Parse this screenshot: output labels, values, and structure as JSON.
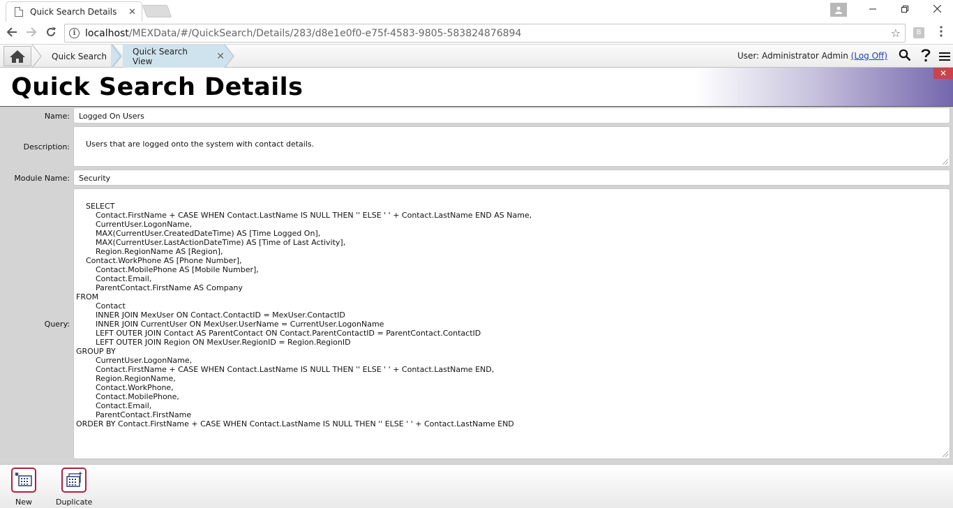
{
  "browser": {
    "tab_title": "Quick Search Details",
    "tab_close": "✕",
    "url_host": "localhost",
    "url_path": "/MEXData/#/QuickSearch/Details/283/d8e1e0f0-e75f-4583-9805-583824876894",
    "ext_badge": "B"
  },
  "nav": {
    "breadcrumbs": [
      {
        "label": "Quick Search"
      },
      {
        "label": "Quick Search View"
      }
    ],
    "crumb_close": "✕",
    "user_prefix": "User: Administrator Admin",
    "logoff": "(Log Off)"
  },
  "page": {
    "title": "Quick Search Details",
    "close": "✕"
  },
  "form": {
    "name_label": "Name:",
    "name_value": "Logged On Users",
    "description_label": "Description:",
    "description_value": "Users that are logged onto the system with contact details.",
    "module_label": "Module Name:",
    "module_value": "Security",
    "query_label": "Query:",
    "query_value": "SELECT\n        Contact.FirstName + CASE WHEN Contact.LastName IS NULL THEN '' ELSE ' ' + Contact.LastName END AS Name,\n        CurrentUser.LogonName,\n        MAX(CurrentUser.CreatedDateTime) AS [Time Logged On],\n        MAX(CurrentUser.LastActionDateTime) AS [Time of Last Activity],\n        Region.RegionName AS [Region],\n    Contact.WorkPhone AS [Phone Number],\n        Contact.MobilePhone AS [Mobile Number],\n        Contact.Email,\n        ParentContact.FirstName AS Company\nFROM\n        Contact\n        INNER JOIN MexUser ON Contact.ContactID = MexUser.ContactID\n        INNER JOIN CurrentUser ON MexUser.UserName = CurrentUser.LogonName\n        LEFT OUTER JOIN Contact AS ParentContact ON Contact.ParentContactID = ParentContact.ContactID\n        LEFT OUTER JOIN Region ON MexUser.RegionID = Region.RegionID\nGROUP BY\n        CurrentUser.LogonName,\n        Contact.FirstName + CASE WHEN Contact.LastName IS NULL THEN '' ELSE ' ' + Contact.LastName END,\n        Region.RegionName,\n        Contact.WorkPhone,\n        Contact.MobilePhone,\n        Contact.Email,\n        ParentContact.FirstName\nORDER BY Contact.FirstName + CASE WHEN Contact.LastName IS NULL THEN '' ELSE ' ' + Contact.LastName END"
  },
  "toolbar": {
    "new_label": "New",
    "duplicate_label": "Duplicate"
  },
  "colors": {
    "accent_purple": "#7466ad",
    "tool_border": "#b0203c",
    "active_crumb": "#cfe3ee",
    "link": "#1a3fbf",
    "close_red": "#c9444a"
  }
}
